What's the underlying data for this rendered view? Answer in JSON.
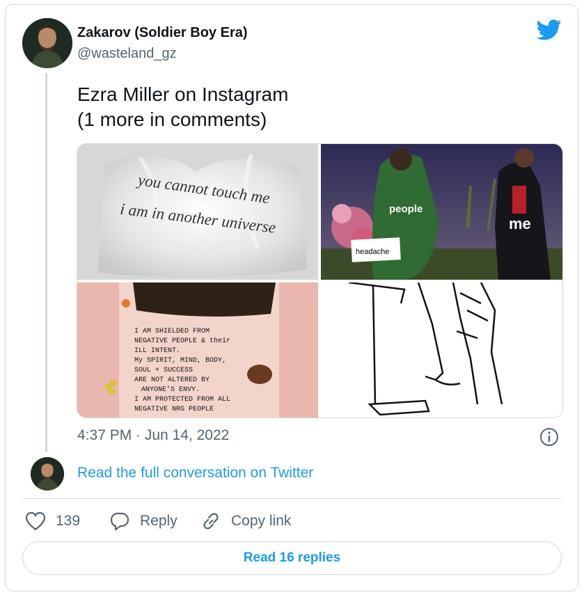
{
  "tweet": {
    "author_name": "Zakarov (Soldier Boy Era)",
    "author_handle": "@wasteland_gz",
    "text_lines": [
      "Ezra Miller on Instagram",
      "(1 more in comments)"
    ],
    "timestamp": "4:37 PM · Jun 14, 2022"
  },
  "media": {
    "image1": {
      "lines": [
        "you cannot touch me",
        "i am in another universe"
      ]
    },
    "image2": {
      "labels": {
        "people": "people",
        "me": "me",
        "headache": "headache"
      }
    },
    "image3": {
      "lines": [
        "I AM SHIELDED FROM",
        "NEGATIVE PEOPLE & their",
        "ILL INTENT.",
        "My SPIRIT, MIND, BODY,",
        "SOUL + SUCCESS",
        "ARE NOT ALTERED BY",
        "ANYONE'S ENVY.",
        "I AM PROTECTED FROM ALL",
        "NEGATIVE NRG PEOPLE"
      ]
    }
  },
  "conversation_link": "Read the full conversation on Twitter",
  "actions": {
    "likes": "139",
    "reply": "Reply",
    "copy_link": "Copy link"
  },
  "read_replies": "Read 16 replies",
  "colors": {
    "accent": "#1d9bf0",
    "muted": "#536471",
    "border": "#cfd9de"
  },
  "icons": [
    "avatar-image",
    "twitter-bird-icon",
    "info-icon",
    "heart-icon",
    "reply-icon",
    "link-icon"
  ]
}
